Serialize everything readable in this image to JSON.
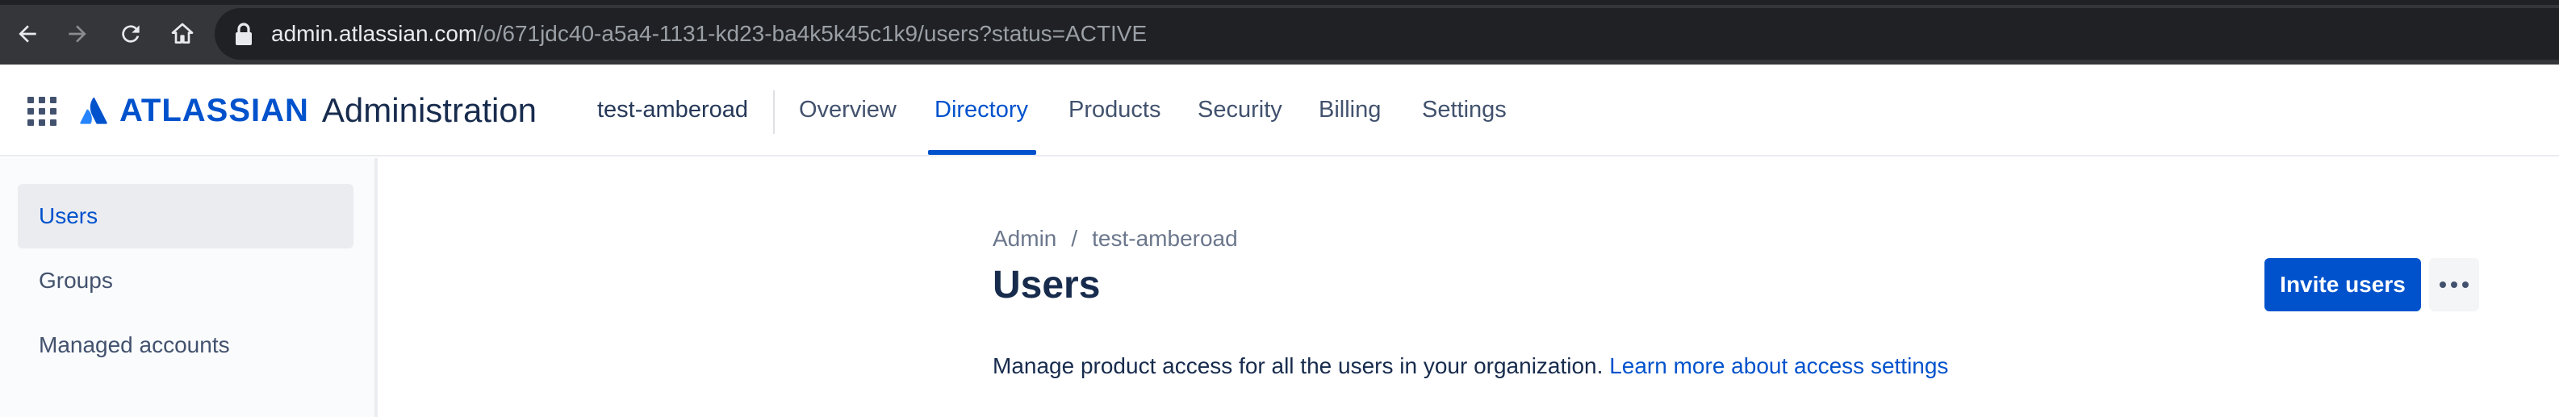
{
  "browser": {
    "url_host": "admin.atlassian.com",
    "url_path": "/o/671jdc40-a5a4-1131-kd23-ba4k5k45c1k9/users?status=ACTIVE",
    "icons": [
      "back-arrow-icon",
      "forward-arrow-icon",
      "reload-icon",
      "home-icon",
      "lock-icon"
    ]
  },
  "header": {
    "logo_word": "ATLASSIAN",
    "logo_product": "Administration",
    "org_name": "test-amberoad",
    "tabs": [
      {
        "label": "Overview",
        "active": false
      },
      {
        "label": "Directory",
        "active": true
      },
      {
        "label": "Products",
        "active": false
      },
      {
        "label": "Security",
        "active": false
      },
      {
        "label": "Billing",
        "active": false
      },
      {
        "label": "Settings",
        "active": false
      }
    ]
  },
  "sidebar": {
    "items": [
      {
        "label": "Users",
        "active": true
      },
      {
        "label": "Groups",
        "active": false
      },
      {
        "label": "Managed accounts",
        "active": false
      }
    ]
  },
  "main": {
    "breadcrumb": [
      "Admin",
      "test-amberoad"
    ],
    "breadcrumb_separator": "/",
    "title": "Users",
    "invite_button": "Invite users",
    "description": "Manage product access for all the users in your organization.",
    "description_link": "Learn more about access settings"
  },
  "colors": {
    "brand_blue": "#0052cc",
    "text_dark": "#172b4d",
    "text_muted": "#6b778c",
    "browser_dark": "#202124"
  }
}
